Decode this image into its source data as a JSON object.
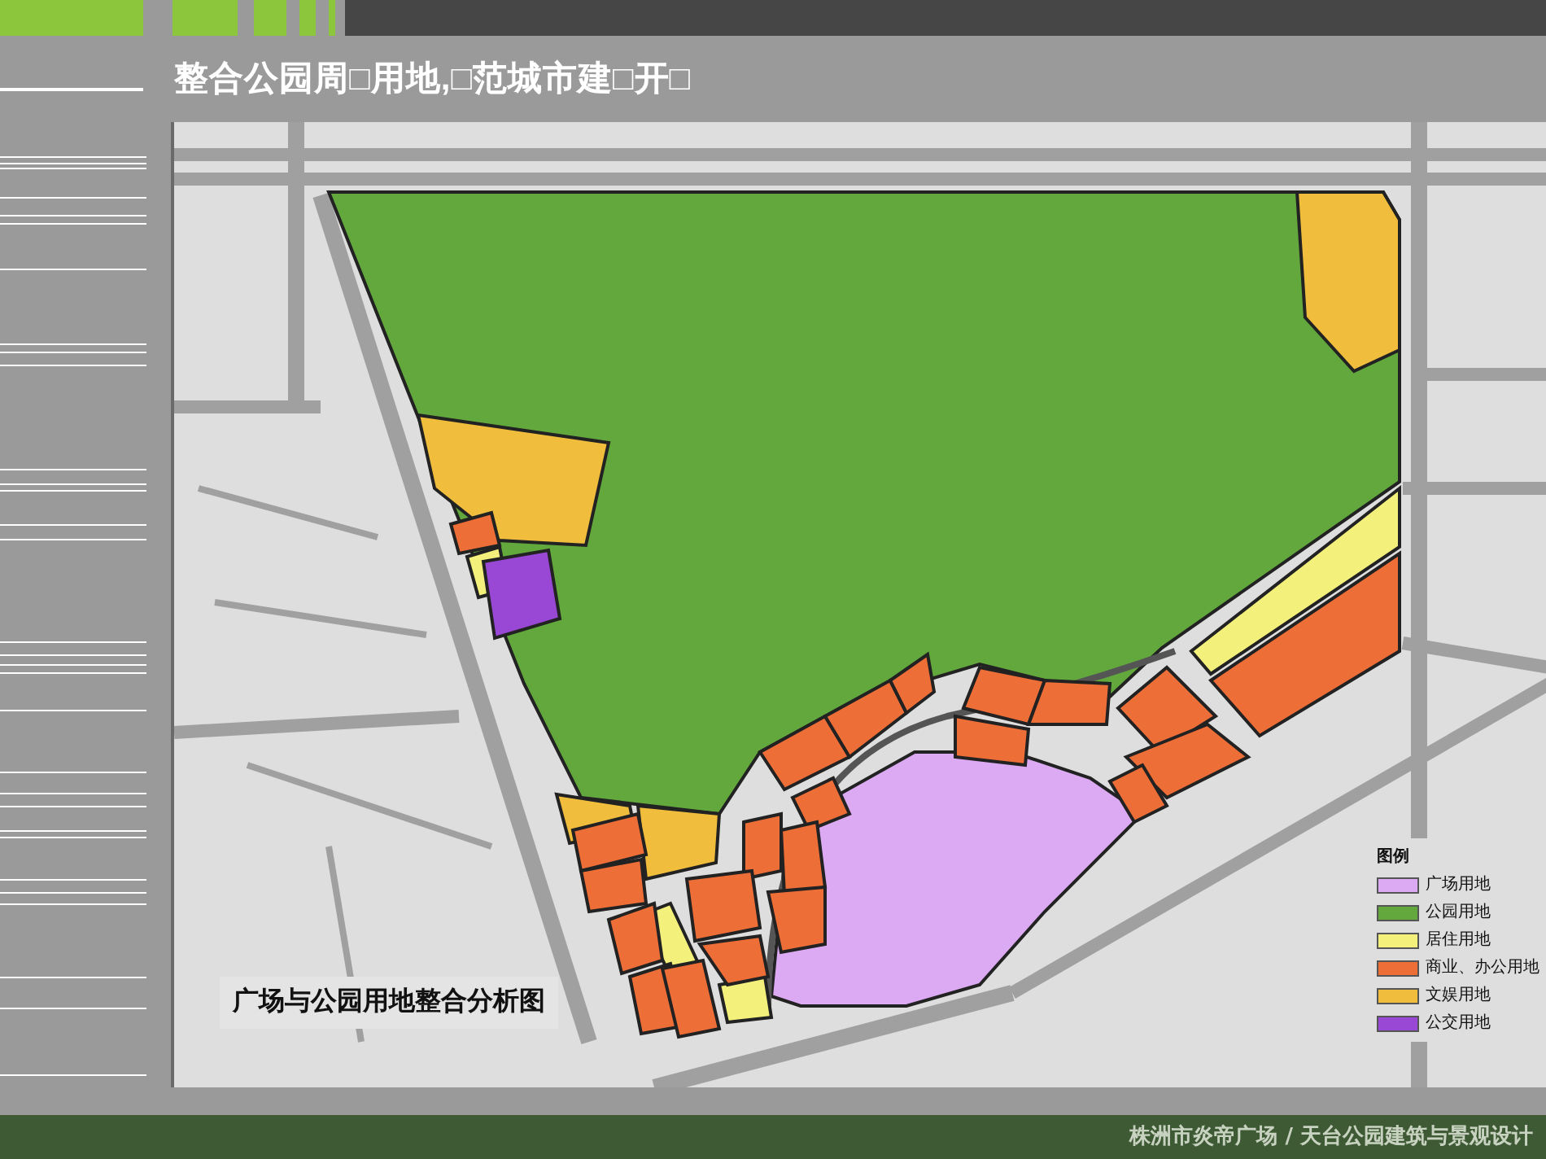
{
  "header": {
    "title": "整合公园周□用地,□范城市建□开□"
  },
  "map": {
    "caption": "广场与公园用地整合分析图",
    "legend": {
      "title": "图例",
      "items": [
        {
          "label": "广场用地",
          "color": "#dcaaf2"
        },
        {
          "label": "公园用地",
          "color": "#62a83c"
        },
        {
          "label": "居住用地",
          "color": "#f4f07c"
        },
        {
          "label": "商业、办公用地",
          "color": "#ee6e38"
        },
        {
          "label": "文娱用地",
          "color": "#f0be3c"
        },
        {
          "label": "公交用地",
          "color": "#9848d4"
        }
      ]
    }
  },
  "footer": {
    "project": "株洲市炎帝广场 / 天台公园建筑与景观设计"
  }
}
